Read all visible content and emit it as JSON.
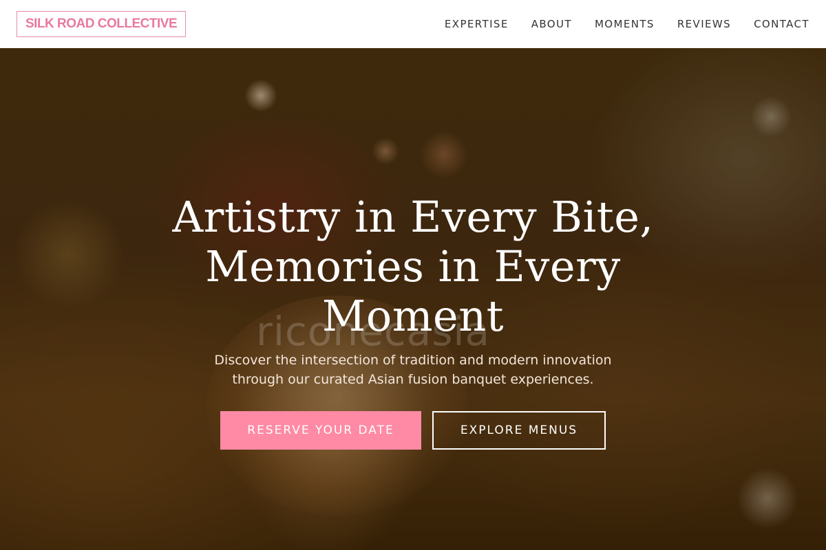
{
  "header": {
    "logo": "SILK ROAD COLLECTIVE",
    "nav": [
      {
        "label": "EXPERTISE"
      },
      {
        "label": "ABOUT"
      },
      {
        "label": "MOMENTS"
      },
      {
        "label": "REVIEWS"
      },
      {
        "label": "CONTACT"
      }
    ]
  },
  "hero": {
    "headline": "Artistry in Every Bite, Memories in Every Moment",
    "subtext": "Discover the intersection of tradition and modern innovation through our curated Asian fusion banquet experiences.",
    "watermark": "riconecasia",
    "primary_button": "RESERVE YOUR DATE",
    "secondary_button": "EXPLORE MENUS"
  },
  "colors": {
    "brand_pink": "#e9799c",
    "button_pink": "#ff8aa5",
    "header_bg": "#ffffff"
  }
}
